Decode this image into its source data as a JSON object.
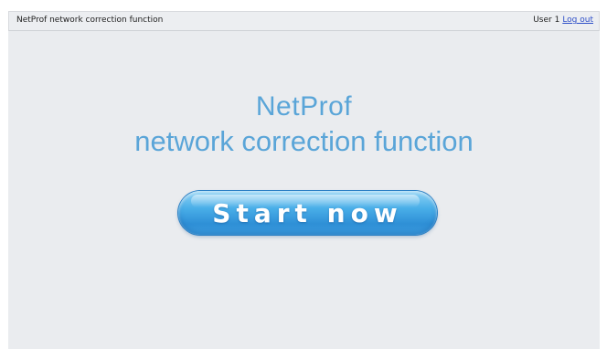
{
  "header": {
    "app_title": "NetProf network correction function",
    "user_label": "User 1",
    "logout_label": "Log out"
  },
  "hero": {
    "line1": "NetProf",
    "line2": "network correction function"
  },
  "actions": {
    "start_label": "Start now"
  },
  "colors": {
    "accent": "#5aa5d8",
    "button": "#3d9ee0",
    "background": "#eaecef",
    "link": "#2d4ec8"
  }
}
